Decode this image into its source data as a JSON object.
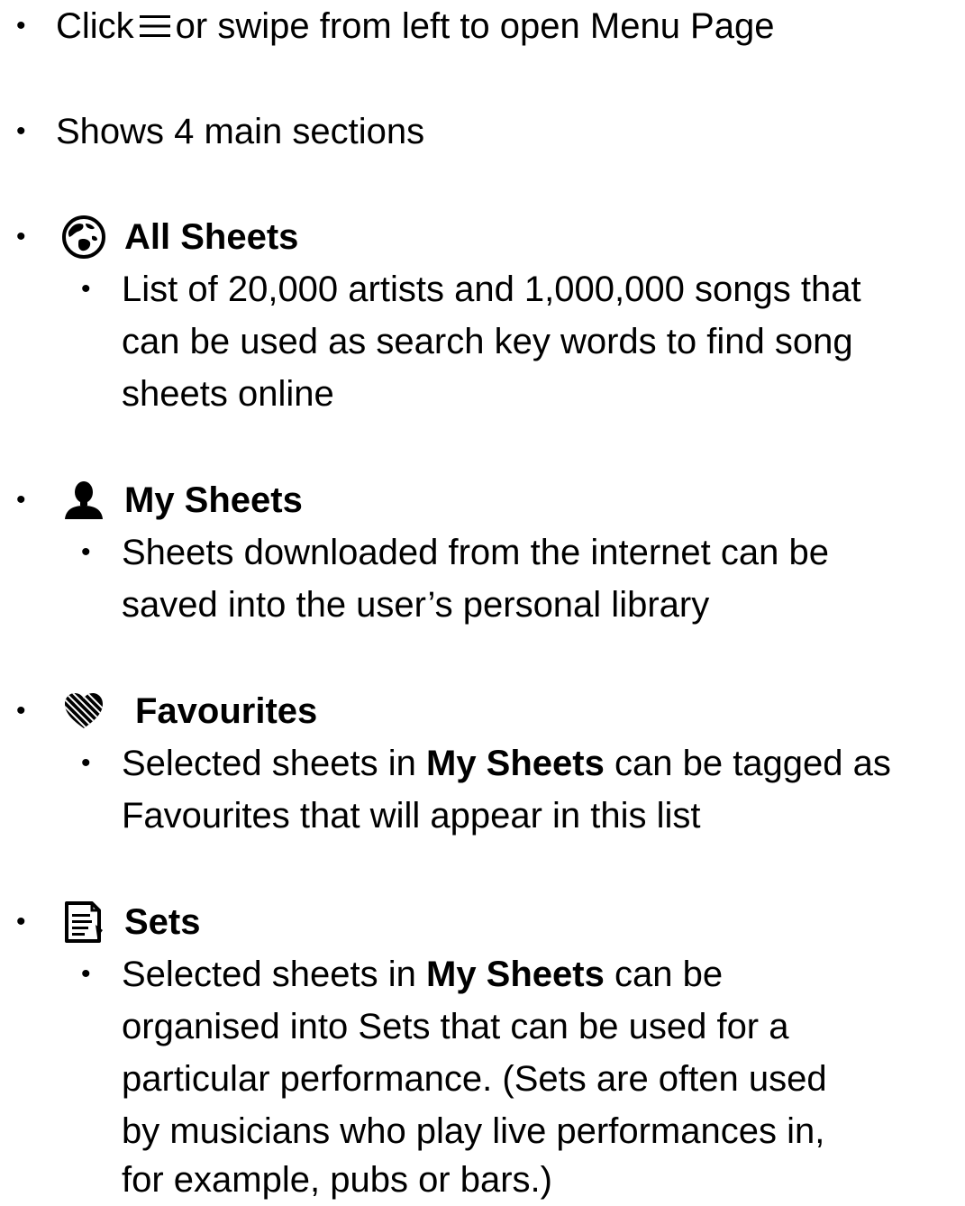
{
  "intro": {
    "line1_before": "Click",
    "line1_icon": "hamburger-menu-icon",
    "line1_after": "or swipe from left to open Menu Page",
    "line2": "Shows 4 main sections"
  },
  "sections": {
    "all_sheets": {
      "icon": "globe-icon",
      "title": "All Sheets",
      "lines": [
        "List of 20,000 artists and 1,000,000 songs that",
        "can be used as search key words to find song",
        "sheets online"
      ]
    },
    "my_sheets": {
      "icon": "person-icon",
      "title": "My Sheets",
      "lines": [
        "Sheets downloaded from the internet can be",
        "saved into the user’s personal library"
      ]
    },
    "favourites": {
      "icon": "heart-icon",
      "title": "Favourites",
      "line1_before": "Selected sheets in",
      "line1_bold": "My Sheets",
      "line1_after": "can be tagged as",
      "line2": "Favourites that will appear in this list"
    },
    "sets": {
      "icon": "document-list-icon",
      "title": "Sets",
      "line1_before": "Selected sheets in",
      "line1_bold": "My Sheets",
      "line1_after": "can be",
      "lines": [
        "organised into Sets that can be used for a",
        "particular performance. (Sets are often used",
        "by musicians who play live performances in,",
        "for example, pubs or bars.)"
      ]
    }
  },
  "colors": {
    "text": "#000000",
    "background": "#ffffff"
  }
}
